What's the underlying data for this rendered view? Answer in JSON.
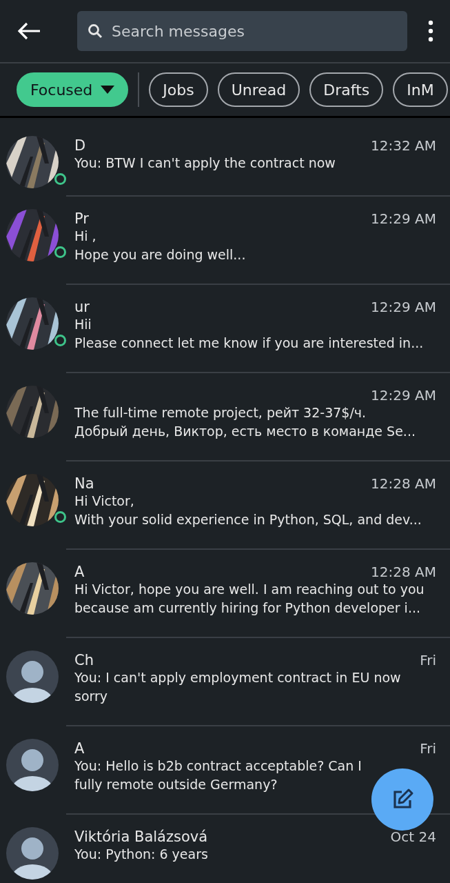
{
  "header": {
    "search": {
      "placeholder": "Search messages"
    }
  },
  "filters": [
    {
      "label": "Focused",
      "selected": true,
      "dropdown": true
    },
    {
      "label": "Jobs",
      "selected": false,
      "dropdown": false
    },
    {
      "label": "Unread",
      "selected": false,
      "dropdown": false
    },
    {
      "label": "Drafts",
      "selected": false,
      "dropdown": false
    },
    {
      "label": "InM",
      "selected": false,
      "dropdown": false
    }
  ],
  "conversations": [
    {
      "name": "D",
      "time": "12:32 AM",
      "preview": [
        "You: BTW I can't apply the contract now"
      ],
      "online": true
    },
    {
      "name": "Pr",
      "time": "12:29 AM",
      "preview": [
        "Hi ,",
        "Hope you are doing well..."
      ],
      "online": true
    },
    {
      "name": "ur",
      "time": "12:29 AM",
      "preview": [
        "Hii",
        "Please connect let me know if you are interested in..."
      ],
      "online": true
    },
    {
      "time": "12:29 AM",
      "preview": [
        "The full-time remote project, рейт 32-37$/ч.",
        "Добрый день, Виктор, есть место в команде Se..."
      ],
      "online": false
    },
    {
      "name": "Na",
      "time": "12:28 AM",
      "preview": [
        "Hi Victor,",
        "With your solid experience in Python, SQL, and dev..."
      ],
      "online": true
    },
    {
      "name": "A",
      "time": "12:28 AM",
      "preview": [
        "Hi Victor, hope you are well. I am reaching out to you because am currently hiring for Python developer i..."
      ],
      "online": false
    },
    {
      "name": "Ch",
      "time": "Fri",
      "preview": [
        "You: I can't apply employment contract in EU now sorry"
      ],
      "kind": "default",
      "online": false
    },
    {
      "name": "A",
      "time": "Fri",
      "preview": [
        "You: Hello is b2b contract acceptable? Can I",
        "fully remote outside Germany?"
      ],
      "kind": "default",
      "online": false
    },
    {
      "name": "Viktória Balázsová",
      "time": "Oct 24",
      "preview": [
        "You: Python: 6 years"
      ],
      "kind": "default",
      "online": false
    }
  ]
}
